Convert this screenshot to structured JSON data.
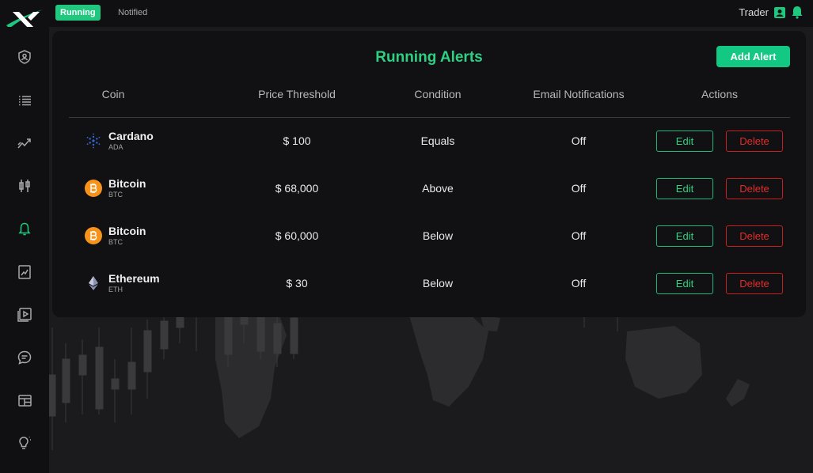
{
  "header": {
    "tabs": [
      {
        "label": "Running",
        "active": true
      },
      {
        "label": "Notified",
        "active": false
      }
    ],
    "user_name": "Trader"
  },
  "sidebar": {
    "items": [
      {
        "icon": "shield-user-icon"
      },
      {
        "icon": "list-icon"
      },
      {
        "icon": "trend-icon"
      },
      {
        "icon": "candlestick-icon"
      },
      {
        "icon": "bell-icon",
        "active": true
      },
      {
        "icon": "report-icon"
      },
      {
        "icon": "play-icon"
      },
      {
        "icon": "chat-icon"
      },
      {
        "icon": "dashboard-icon"
      },
      {
        "icon": "lightbulb-icon"
      }
    ]
  },
  "panel": {
    "title": "Running Alerts",
    "add_button": "Add Alert",
    "columns": [
      "Coin",
      "Price Threshold",
      "Condition",
      "Email Notifications",
      "Actions"
    ],
    "rows": [
      {
        "coin": "Cardano",
        "symbol": "ADA",
        "icon": "cardano-icon",
        "price": "$ 100",
        "condition": "Equals",
        "email": "Off",
        "edit": "Edit",
        "delete": "Delete"
      },
      {
        "coin": "Bitcoin",
        "symbol": "BTC",
        "icon": "bitcoin-icon",
        "price": "$ 68,000",
        "condition": "Above",
        "email": "Off",
        "edit": "Edit",
        "delete": "Delete"
      },
      {
        "coin": "Bitcoin",
        "symbol": "BTC",
        "icon": "bitcoin-icon",
        "price": "$ 60,000",
        "condition": "Below",
        "email": "Off",
        "edit": "Edit",
        "delete": "Delete"
      },
      {
        "coin": "Ethereum",
        "symbol": "ETH",
        "icon": "ethereum-icon",
        "price": "$ 30",
        "condition": "Below",
        "email": "Off",
        "edit": "Edit",
        "delete": "Delete"
      }
    ]
  },
  "colors": {
    "accent": "#1fc87e",
    "danger": "#e32b2b",
    "bitcoin": "#f7931a",
    "cardano": "#3468d1"
  }
}
